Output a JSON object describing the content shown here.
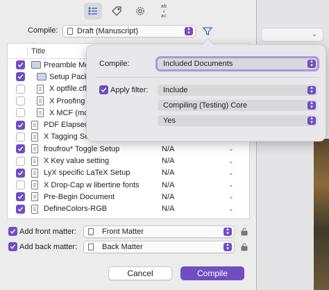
{
  "toolbar": {
    "icons": [
      "list-icon",
      "tag-icon",
      "gear-icon",
      "abc-replace-icon"
    ],
    "abc_top": "ab",
    "abc_bottom": "ac"
  },
  "compile": {
    "label": "Compile:",
    "format": "Draft (Manuscript)"
  },
  "table": {
    "column_title": "Title",
    "rows": [
      {
        "checked": true,
        "icon": "folder-stack",
        "indent": 0,
        "name": "Preamble Mo",
        "format": ""
      },
      {
        "checked": true,
        "icon": "folder",
        "indent": 1,
        "name": "Setup Pack",
        "format": ""
      },
      {
        "checked": false,
        "icon": "doc",
        "indent": 1,
        "name": "X optfile.cfl",
        "format": ""
      },
      {
        "checked": false,
        "icon": "doc",
        "indent": 1,
        "name": "X Proofing",
        "format": ""
      },
      {
        "checked": false,
        "icon": "doc",
        "indent": 1,
        "name": "X MCF (mc",
        "format": ""
      },
      {
        "checked": true,
        "icon": "doc",
        "indent": 0,
        "name": "PDF Elapsed",
        "format": ""
      },
      {
        "checked": false,
        "icon": "doc",
        "indent": 0,
        "name": "X Tagging Se",
        "format": ""
      },
      {
        "checked": true,
        "icon": "doc",
        "indent": 0,
        "name": "froufrou* Toggle Setup",
        "format": "N/A"
      },
      {
        "checked": false,
        "icon": "doc",
        "indent": 0,
        "name": "X Key value setting",
        "format": "N/A"
      },
      {
        "checked": true,
        "icon": "doc",
        "indent": 0,
        "name": "LyX specific LaTeX Setup",
        "format": "N/A"
      },
      {
        "checked": false,
        "icon": "doc",
        "indent": 0,
        "name": "X Drop-Cap w libertine fonts",
        "format": "N/A"
      },
      {
        "checked": true,
        "icon": "doc",
        "indent": 0,
        "name": "Pre-Begin Document",
        "format": "N/A"
      },
      {
        "checked": true,
        "icon": "doc",
        "indent": 0,
        "name": "DefineColors-RGB",
        "format": "N/A"
      }
    ]
  },
  "front_matter": {
    "checked": true,
    "label": "Add front matter:",
    "value": "Front Matter"
  },
  "back_matter": {
    "checked": true,
    "label": "Add back matter:",
    "value": "Back Matter"
  },
  "buttons": {
    "cancel": "Cancel",
    "compile": "Compile"
  },
  "popover": {
    "compile_label": "Compile:",
    "compile_value": "Included Documents",
    "apply_filter_checked": true,
    "apply_filter_label": "Apply filter:",
    "filter_mode": "Include",
    "filter_target": "Compiling (Testing) Core",
    "filter_value": "Yes"
  },
  "colors": {
    "accent": "#6f4ec2",
    "focus_ring": "#a996e0",
    "link_blue": "#3a64d8"
  }
}
